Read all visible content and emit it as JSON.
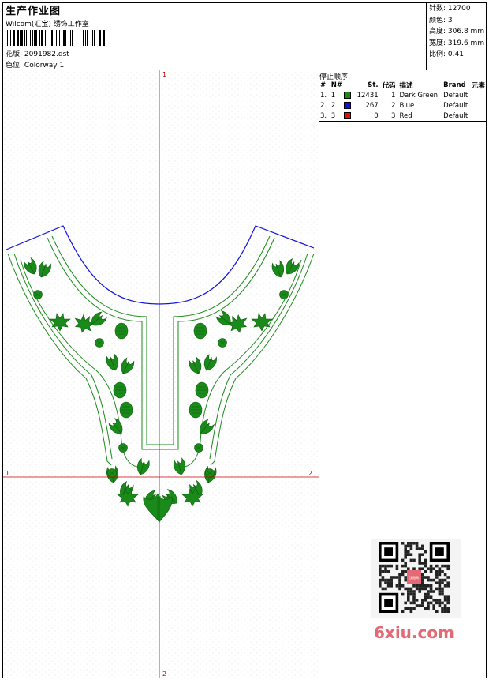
{
  "header": {
    "title": "生产作业图",
    "subtitle": "Wilcom(汇宝) 绣饰工作室",
    "design_label": "花版:",
    "design_value": "2091982.dst",
    "colorway_label": "色位:",
    "colorway_value": "Colorway 1"
  },
  "stats": {
    "stitches_label": "针数:",
    "stitches_value": "12700",
    "colors_label": "颜色:",
    "colors_value": "3",
    "height_label": "高度:",
    "height_value": "306.8 mm",
    "width_label": "宽度:",
    "width_value": "319.6 mm",
    "scale_label": "比例:",
    "scale_value": "0.41"
  },
  "stop_sequence": {
    "title": "停止顺序:",
    "columns": [
      "#",
      "N#",
      "St.",
      "代码",
      "描述",
      "Brand",
      "元素"
    ],
    "rows": [
      {
        "num": "1.",
        "n": "1",
        "color": "#1a8a1a",
        "st": "12431",
        "code": "1",
        "desc": "Dark Green",
        "brand": "Default"
      },
      {
        "num": "2.",
        "n": "2",
        "color": "#1010e0",
        "st": "267",
        "code": "2",
        "desc": "Blue",
        "brand": "Default"
      },
      {
        "num": "3.",
        "n": "3",
        "color": "#e01010",
        "st": "0",
        "code": "3",
        "desc": "Red",
        "brand": "Default"
      }
    ]
  },
  "axes": {
    "top": "1",
    "bottom": "2",
    "left": "1",
    "right": "2"
  },
  "watermark": "6xiu.com",
  "seal_text": "汉图网",
  "colors": {
    "thread_green": "#1a8a1a",
    "thread_blue": "#1010e0",
    "axis_red": "#d00000",
    "watermark": "#e36a75"
  }
}
